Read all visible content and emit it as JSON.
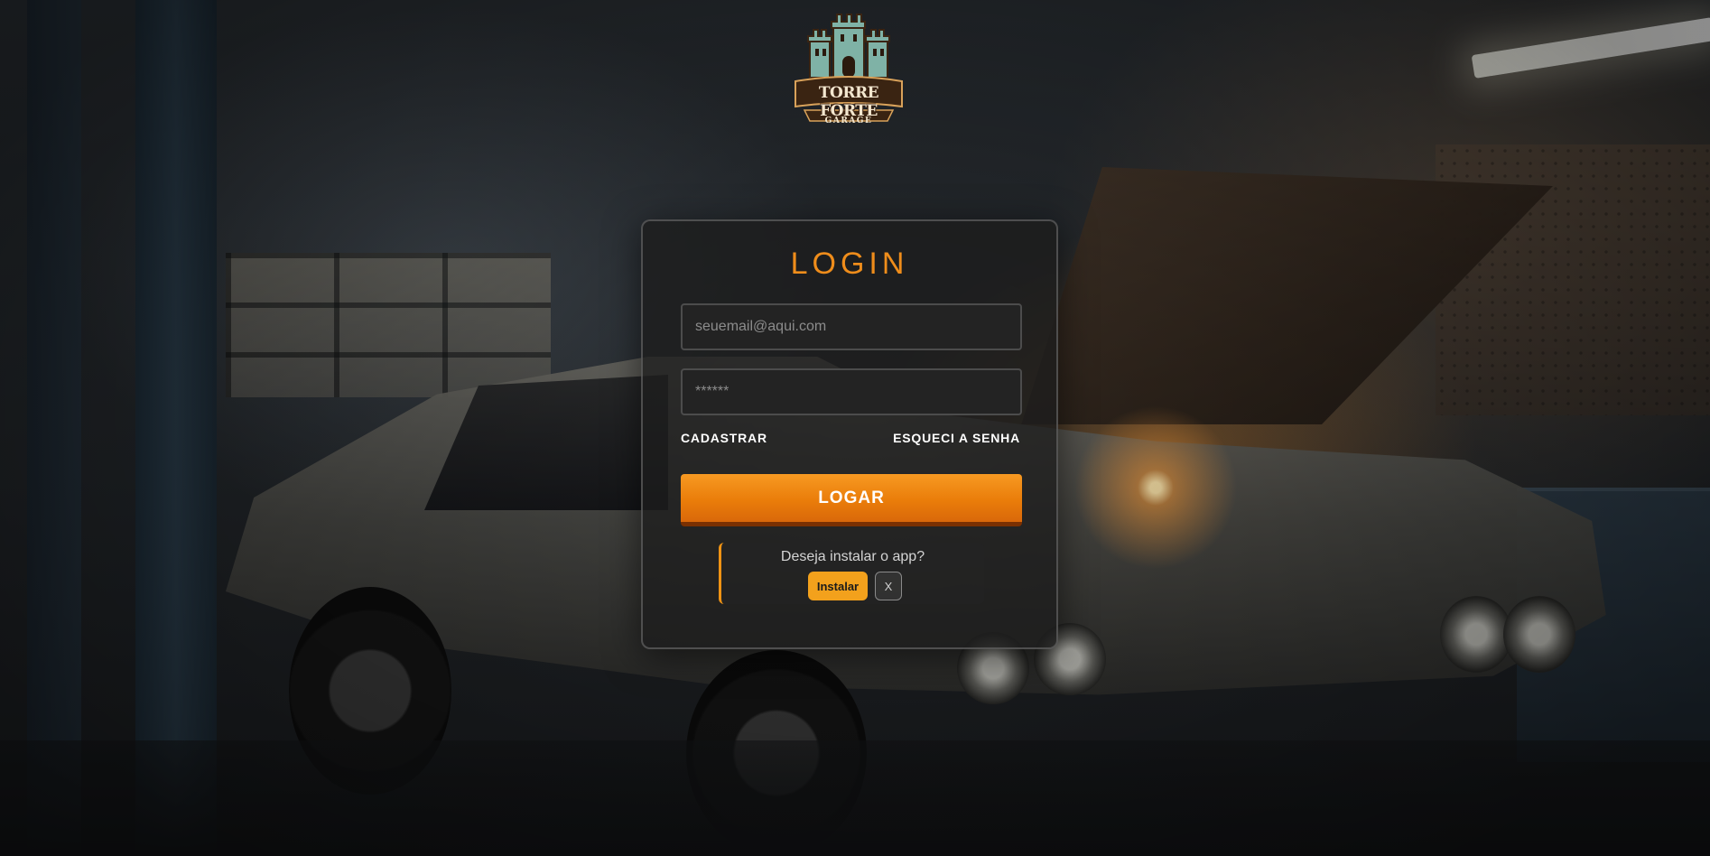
{
  "brand": {
    "name": "TORRE FORTE",
    "tagline": "GARAGE"
  },
  "login": {
    "title": "LOGIN",
    "email": {
      "value": "",
      "placeholder": "seuemail@aqui.com"
    },
    "password": {
      "value": "",
      "placeholder": "******"
    },
    "register_link": "CADASTRAR",
    "forgot_link": "ESQUECI A SENHA",
    "submit_label": "LOGAR"
  },
  "install_prompt": {
    "message": "Deseja instalar o app?",
    "install_label": "Instalar",
    "dismiss_label": "X"
  },
  "colors": {
    "accent": "#ef8d1b",
    "button": "#ea7d0a",
    "install_button": "#f3a11c"
  },
  "icons": {
    "logo": "castle-logo-icon"
  }
}
